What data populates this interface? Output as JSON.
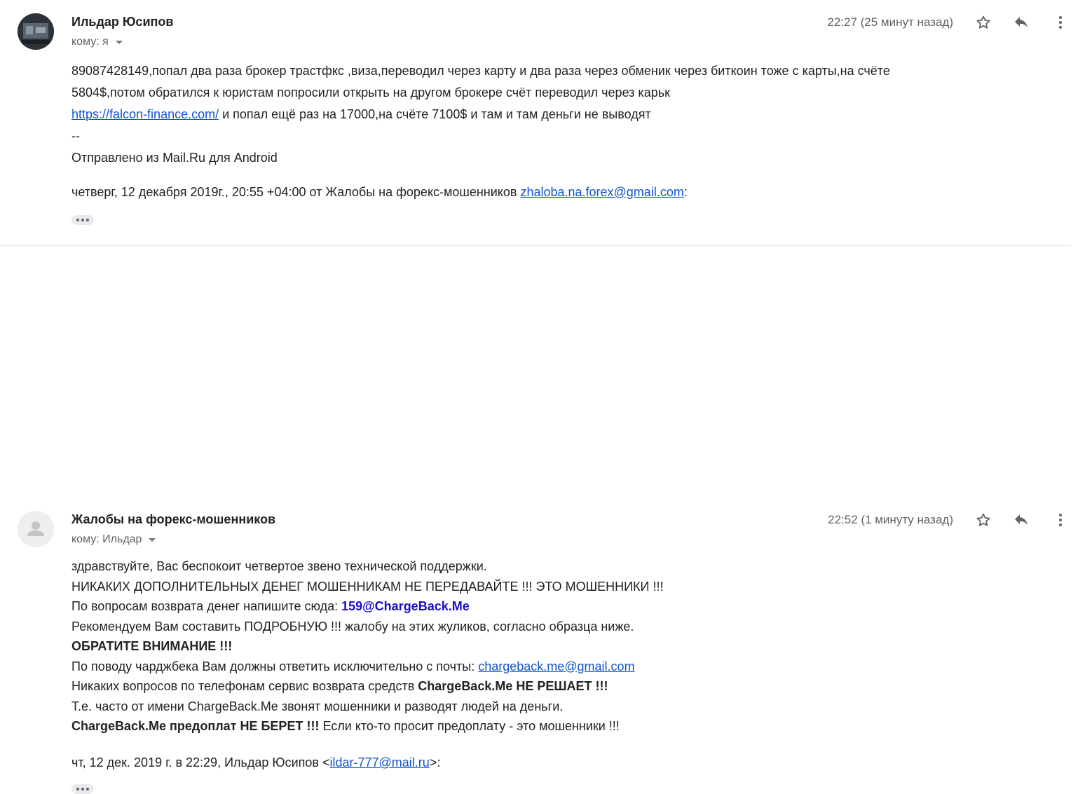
{
  "messages": [
    {
      "sender": "Ильдар Юсипов",
      "to_label": "кому: я",
      "time": "22:27 (25 минут назад)",
      "body": {
        "line1": "89087428149,попал два раза брокер трастфкс ,виза,переводил через карту и два раза через обменик через биткоин тоже с карты,на счёте",
        "line2": "5804$,потом обратился к юристам попросили открыть на другом брокере счёт переводил через карьк",
        "line3_link": "https://falcon-finance.com/",
        "line3_rest": " и попал ещё раз на 17000,на счёте 7100$ и там и там деньги не выводят",
        "line4": "--",
        "line5": "Отправлено из Mail.Ru для Android"
      },
      "quote_header": {
        "prefix": "четверг, 12 декабря 2019г., 20:55 +04:00 от Жалобы на форекс-мошенников ",
        "email": "zhaloba.na.forex@gmail.com",
        "suffix": ":"
      },
      "avatar_icon": "user-photo"
    },
    {
      "sender": "Жалобы на форекс-мошенников",
      "to_label": "кому: Ильдар",
      "time": "22:52 (1 минуту назад)",
      "body": {
        "l1": "здравствуйте, Вас беспокоит четвертое звено технической поддержки.",
        "l2": "НИКАКИХ ДОПОЛНИТЕЛЬНЫХ ДЕНЕГ МОШЕННИКАМ НЕ ПЕРЕДАВАЙТЕ !!! ЭТО МОШЕННИКИ !!!",
        "l3_prefix": "По вопросам возврата денег напишите сюда: ",
        "l3_email": "159@ChargeBack.Me",
        "l4": "Рекомендуем Вам составить ПОДРОБНУЮ !!! жалобу на этих жуликов, согласно образца ниже.",
        "l5": "ОБРАТИТЕ ВНИМАНИЕ !!!",
        "l6_prefix": "По поводу чарджбека Вам должны ответить исключительно с почты: ",
        "l6_email": "chargeback.me@gmail.com",
        "l7_prefix": "Никаких вопросов по телефонам сервис возврата средств ",
        "l7_bold": "ChargeBack.Me НЕ РЕШАЕТ !!!",
        "l8": "Т.е. часто от имени ChargeBack.Me звонят мошенники и разводят людей на деньги.",
        "l9_bold": "ChargeBack.Me предоплат НЕ БЕРЕТ !!!",
        "l9_rest": " Если кто-то просит предоплату - это мошенники !!!"
      },
      "quote_header": {
        "prefix": "чт, 12 дек. 2019 г. в 22:29, Ильдар Юсипов <",
        "email": "ildar-777@mail.ru",
        "suffix": ">:"
      },
      "avatar_icon": "default-user-icon"
    }
  ],
  "icons": {
    "star": "star-outline-icon",
    "reply": "reply-icon",
    "more": "more-vert-icon",
    "ellipsis": "trimmed-content-icon"
  },
  "colors": {
    "link": "#1155cc",
    "muted": "#5f6368",
    "text": "#222222"
  }
}
